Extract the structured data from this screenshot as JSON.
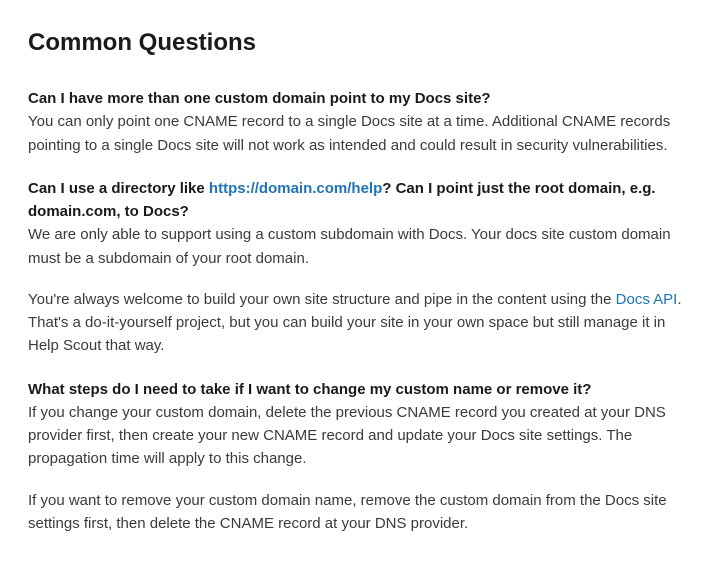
{
  "heading": "Common Questions",
  "q1": {
    "question": "Can I have more than one custom domain point to my Docs site?",
    "answer": "You can only point one CNAME record to a single Docs site at a time. Additional CNAME records pointing to a single Docs site will not work as intended and could result in security vulnerabilities."
  },
  "q2": {
    "question_pre": "Can I use a directory like ",
    "question_link": "https://domain.com/help",
    "question_post": "? Can I point just the root domain, e.g. domain.com, to Docs?",
    "answer1": "We are only able to support using a custom subdomain with Docs. Your docs site custom domain must be a subdomain of your root domain.",
    "answer2_pre": "You're always welcome to build your own site structure and pipe in the content using the ",
    "answer2_link": "Docs API",
    "answer2_post": ". That's a do-it-yourself project, but you can build your site in your own space but still manage it in Help Scout that way."
  },
  "q3": {
    "question": "What steps do I need to take if I want to change my custom name or remove it?",
    "answer1": "If you change your custom domain, delete the previous CNAME record you created at your DNS provider first, then create your new CNAME record and update your Docs site settings. The propagation time will apply to this change.",
    "answer2": "If you want to remove your custom domain name, remove the custom domain from the Docs site settings first, then delete the CNAME record at your DNS provider."
  }
}
